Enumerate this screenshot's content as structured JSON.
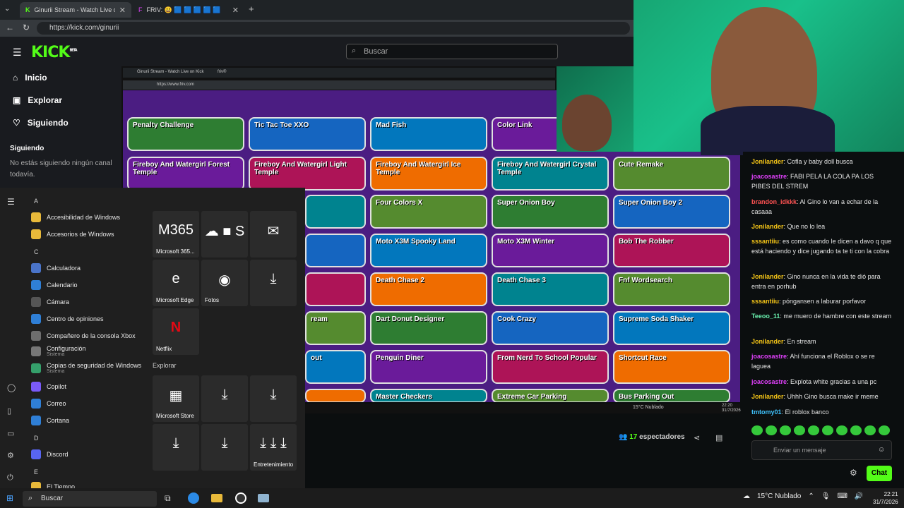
{
  "browser": {
    "tabs": [
      {
        "label": "Ginurii Stream - Watch Live on Kick",
        "active": true
      },
      {
        "label": "FRIV: 😃 🟦 🟦 🟦 🟦 🟦",
        "active": false
      }
    ],
    "new_tab": "+",
    "url": "https://kick.com/ginurii"
  },
  "kick": {
    "logo": "KICK",
    "logo_badge": "BETA",
    "search_placeholder": "Buscar",
    "nav": [
      {
        "label": "Inicio",
        "icon": "home-icon"
      },
      {
        "label": "Explorar",
        "icon": "compass-icon"
      },
      {
        "label": "Siguiendo",
        "icon": "heart-icon"
      }
    ],
    "following_title": "Siguiendo",
    "following_empty": "No estás siguiendo ningún canal todavía."
  },
  "inner_browser": {
    "tab1": "Ginurii Stream - Watch Live on Kick",
    "tab2": "friv®",
    "url": "https://www.friv.com"
  },
  "games": [
    [
      "Penalty Challenge",
      "Tic Tac Toe XXO",
      "Mad Fish",
      "Color Link"
    ],
    [
      "Fireboy And Watergirl Forest Temple",
      "Fireboy And Watergirl Light Temple",
      "Fireboy And Watergirl Ice Temple",
      "Fireboy And Watergirl Crystal Temple",
      "Cute Remake"
    ],
    [
      "",
      "Four Colors X",
      "Super Onion Boy",
      "Super Onion Boy 2"
    ],
    [
      "",
      "Moto X3M Spooky Land",
      "Moto X3M Winter",
      "Bob The Robber"
    ],
    [
      "",
      "Death Chase 2",
      "Death Chase 3",
      "Fnf Wordsearch"
    ],
    [
      "ream",
      "Dart Donut Designer",
      "Cook Crazy",
      "Supreme Soda Shaker"
    ],
    [
      "out",
      "Penguin Diner",
      "From Nerd To School Popular",
      "Shortcut Race"
    ],
    [
      "",
      "Master Checkers",
      "Extreme Car Parking",
      "Bus Parking Out"
    ]
  ],
  "stream_overlay": {
    "weather": "15°C Nublado",
    "time": "22:20",
    "date": "31/7/2026"
  },
  "chat": {
    "messages": [
      {
        "user": "Jonilander",
        "color": "#f5c518",
        "text": "Cofla y baby doll busca"
      },
      {
        "user": "joacosastre",
        "color": "#e040fb",
        "text": "FABI PELA LA COLA PA LOS PIBES DEL STREM"
      },
      {
        "user": "brandon_idkkk",
        "color": "#ff5252",
        "text": "Al Gino lo van a echar de la casaaa"
      },
      {
        "user": "Jonilander",
        "color": "#f5c518",
        "text": "Que no lo lea"
      },
      {
        "user": "sssantiiu",
        "color": "#f5c518",
        "text": "es como cuando le dicen a davo q que está haciendo y dice jugando ta te ti con la cobra"
      },
      {
        "user": "Jonilander",
        "color": "#f5c518",
        "text": "Gino nunca en la vida te dió para entra en porhub"
      },
      {
        "user": "sssantiiu",
        "color": "#f5c518",
        "text": "póngansen a laburar porfavor"
      },
      {
        "user": "Teeoo_11",
        "color": "#69f0ae",
        "text": "me muero de hambre con este stream"
      },
      {
        "user": "Jonilander",
        "color": "#f5c518",
        "text": "En stream"
      },
      {
        "user": "joacosastre",
        "color": "#e040fb",
        "text": "Ahí funciona el Roblox o se re laguea"
      },
      {
        "user": "joacosastre",
        "color": "#e040fb",
        "text": "Explota white gracias a una pc"
      },
      {
        "user": "Jonilander",
        "color": "#f5c518",
        "text": "Uhhh Gino busca make ir meme"
      },
      {
        "user": "tmtomy01",
        "color": "#40c4ff",
        "text": "El roblox banco"
      }
    ],
    "input_placeholder": "Enviar un mensaje",
    "send_label": "Chat"
  },
  "viewers": {
    "count": "17",
    "label": "espectadores"
  },
  "start_menu": {
    "letters": [
      "A",
      "C",
      "D",
      "E"
    ],
    "apps": [
      {
        "label": "Accesibilidad de Windows",
        "color": "#e8b93a"
      },
      {
        "label": "Accesorios de Windows",
        "color": "#e8b93a"
      },
      {
        "label": "Calculadora",
        "color": "#4a74c9"
      },
      {
        "label": "Calendario",
        "color": "#2f7fd6"
      },
      {
        "label": "Cámara",
        "color": "#555"
      },
      {
        "label": "Centro de opiniones",
        "color": "#2f7fd6"
      },
      {
        "label": "Compañero de la consola Xbox",
        "color": "#6e6e6e"
      },
      {
        "label": "Configuración",
        "sub": "Sistema",
        "color": "#777"
      },
      {
        "label": "Copias de seguridad de Windows",
        "sub": "Sistema",
        "color": "#35a06b"
      },
      {
        "label": "Copilot",
        "color": "#7a5af8"
      },
      {
        "label": "Correo",
        "color": "#2f7fd6"
      },
      {
        "label": "Cortana",
        "color": "#2f7fd6"
      },
      {
        "label": "Discord",
        "color": "#5865f2"
      },
      {
        "label": "El Tiempo",
        "color": "#e8b93a"
      }
    ],
    "pins": [
      {
        "label": "Microsoft 365...",
        "glyph": "M365"
      },
      {
        "label": "",
        "glyph": "☁ ■ S"
      },
      {
        "label": "",
        "glyph": "✉"
      },
      {
        "label": "Microsoft Edge",
        "glyph": "e"
      },
      {
        "label": "Fotos",
        "glyph": "◉"
      },
      {
        "label": "",
        "glyph": "⤓"
      },
      {
        "label": "Netflix",
        "glyph": "N"
      },
      {
        "label": "Microsoft Store",
        "glyph": "▦"
      },
      {
        "label": "",
        "glyph": "⤓"
      },
      {
        "label": "",
        "glyph": "⤓"
      },
      {
        "label": "",
        "glyph": "⤓"
      },
      {
        "label": "",
        "glyph": "⤓"
      },
      {
        "label": "Entretenimiento",
        "glyph": "⤓ ⤓ ⤓"
      }
    ],
    "section_label": "Explorar"
  },
  "taskbar": {
    "search": "Buscar",
    "weather": "15°C Nublado",
    "time": "22:21",
    "date": "31/7/2026"
  }
}
